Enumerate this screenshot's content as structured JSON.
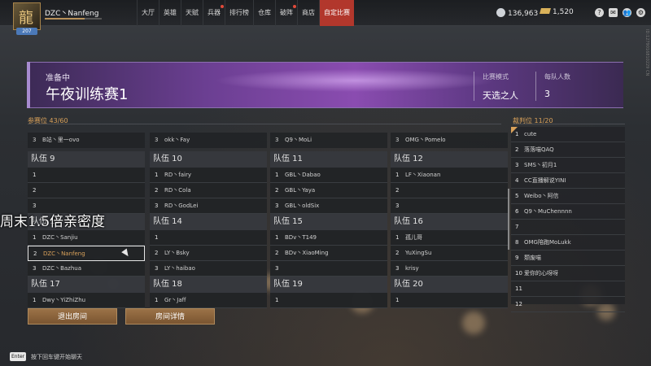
{
  "user": {
    "name": "DZC丶Nanfeng",
    "level": "207",
    "xp_fraction": 0.7
  },
  "nav": [
    {
      "label": "大厅",
      "active": false
    },
    {
      "label": "英雄",
      "active": false
    },
    {
      "label": "天赋",
      "active": false
    },
    {
      "label": "兵器",
      "active": false,
      "badge": true
    },
    {
      "label": "排行榜",
      "active": false
    },
    {
      "label": "仓库",
      "active": false
    },
    {
      "label": "破阵",
      "active": false,
      "badge": true
    },
    {
      "label": "商店",
      "active": false
    },
    {
      "label": "自定比赛",
      "active": true
    }
  ],
  "currency": {
    "silver": "136,963",
    "gold": "1,520"
  },
  "side_id": "ID:1279016810229 CN",
  "banner": {
    "status": "准备中",
    "title": "午夜训练赛1",
    "mode_label": "比赛模式",
    "mode_value": "天选之人",
    "team_size_label": "每队人数",
    "team_size_value": "3"
  },
  "participants_label": "参赛位 43/60",
  "referee_label": "裁判位 11/20",
  "top_partial": [
    {
      "num": "3",
      "name": "B站丶里一ovo"
    },
    {
      "num": "3",
      "name": "okk丶Fay"
    },
    {
      "num": "3",
      "name": "Q9丶MoLi"
    },
    {
      "num": "3",
      "name": "OMG丶Pomelo"
    }
  ],
  "teams": [
    {
      "name": "队伍 9",
      "slots": [
        {
          "num": "1",
          "player": ""
        },
        {
          "num": "2",
          "player": ""
        },
        {
          "num": "3",
          "player": ""
        }
      ]
    },
    {
      "name": "队伍 10",
      "slots": [
        {
          "num": "1",
          "player": "RD丶fairy"
        },
        {
          "num": "2",
          "player": "RD丶Cola"
        },
        {
          "num": "3",
          "player": "RD丶GodLei"
        }
      ]
    },
    {
      "name": "队伍 11",
      "slots": [
        {
          "num": "1",
          "player": "GBL丶Dabao"
        },
        {
          "num": "2",
          "player": "GBL丶Yaya"
        },
        {
          "num": "3",
          "player": "GBL丶oldSix"
        }
      ]
    },
    {
      "name": "队伍 12",
      "slots": [
        {
          "num": "1",
          "player": "LF丶Xiaonan"
        },
        {
          "num": "2",
          "player": ""
        },
        {
          "num": "3",
          "player": ""
        }
      ]
    },
    {
      "name": "队伍 13",
      "slots": [
        {
          "num": "1",
          "player": "DZC丶Sanjiu"
        },
        {
          "num": "2",
          "player": "DZC丶Nanfeng"
        },
        {
          "num": "3",
          "player": "DZC丶Bazhua"
        }
      ]
    },
    {
      "name": "队伍 14",
      "slots": [
        {
          "num": "1",
          "player": ""
        },
        {
          "num": "2",
          "player": "LY丶Bsky"
        },
        {
          "num": "3",
          "player": "LY丶haibao"
        }
      ]
    },
    {
      "name": "队伍 15",
      "slots": [
        {
          "num": "1",
          "player": "BDv丶T149"
        },
        {
          "num": "2",
          "player": "BDv丶XiaoMing"
        },
        {
          "num": "3",
          "player": ""
        }
      ]
    },
    {
      "name": "队伍 16",
      "slots": [
        {
          "num": "1",
          "player": "孤儿哥"
        },
        {
          "num": "2",
          "player": "YuXingSu"
        },
        {
          "num": "3",
          "player": "krisy"
        }
      ]
    },
    {
      "name": "队伍 17",
      "slots": [
        {
          "num": "1",
          "player": "Dwy丶YiZhiZhu"
        }
      ]
    },
    {
      "name": "队伍 18",
      "slots": [
        {
          "num": "1",
          "player": "Gr丶Jaff"
        }
      ]
    },
    {
      "name": "队伍 19",
      "slots": [
        {
          "num": "1",
          "player": ""
        }
      ]
    },
    {
      "name": "队伍 20",
      "slots": [
        {
          "num": "1",
          "player": ""
        }
      ]
    }
  ],
  "referees": [
    {
      "num": "1",
      "name": "cute"
    },
    {
      "num": "2",
      "name": "落落喵QAQ"
    },
    {
      "num": "3",
      "name": "SMS丶初月1"
    },
    {
      "num": "4",
      "name": "CC直播解说YINI"
    },
    {
      "num": "5",
      "name": "Weibo丶阿信"
    },
    {
      "num": "6",
      "name": "Q9丶MuChennnn"
    },
    {
      "num": "7",
      "name": ""
    },
    {
      "num": "8",
      "name": "OMG陪跑MoLukk"
    },
    {
      "num": "9",
      "name": "颓废喵"
    },
    {
      "num": "10",
      "name": "爱你的心呀呀"
    },
    {
      "num": "11",
      "name": ""
    },
    {
      "num": "12",
      "name": ""
    }
  ],
  "overlay_caption": "周末1.5倍亲密度",
  "buttons": {
    "leave": "退出房间",
    "details": "房间详情"
  },
  "chat": {
    "key": "Enter",
    "hint": "按下回车键开始聊天"
  }
}
